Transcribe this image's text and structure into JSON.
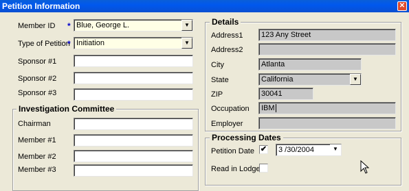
{
  "window": {
    "title": "Petition Information",
    "close_glyph": "✕"
  },
  "left": {
    "member_id": {
      "label": "Member ID",
      "required": "*",
      "value": "Blue, George L."
    },
    "type_of_petition": {
      "label": "Type of Petition",
      "required": "*",
      "value": "Initiation"
    },
    "sponsor1": {
      "label": "Sponsor #1",
      "value": ""
    },
    "sponsor2": {
      "label": "Sponsor #2",
      "value": ""
    },
    "sponsor3": {
      "label": "Sponsor #3",
      "value": ""
    }
  },
  "investigation": {
    "title": "Investigation Committee",
    "chairman": {
      "label": "Chairman",
      "value": ""
    },
    "member1": {
      "label": "Member #1",
      "value": ""
    },
    "member2": {
      "label": "Member #2",
      "value": ""
    },
    "member3": {
      "label": "Member #3",
      "value": ""
    }
  },
  "details": {
    "title": "Details",
    "address1": {
      "label": "Address1",
      "value": "123 Any Street"
    },
    "address2": {
      "label": "Address2",
      "value": ""
    },
    "city": {
      "label": "City",
      "value": "Atlanta"
    },
    "state": {
      "label": "State",
      "value": "California"
    },
    "zip": {
      "label": "ZIP",
      "value": "30041"
    },
    "occupation": {
      "label": "Occupation",
      "value": "IBM"
    },
    "employer": {
      "label": "Employer",
      "value": ""
    }
  },
  "processing": {
    "title": "Processing Dates",
    "petition_date": {
      "label": "Petition Date",
      "checked": "✔",
      "value": "3 /30/2004"
    },
    "read_in_lodge": {
      "label": "Read in Lodge",
      "checked": ""
    }
  },
  "icons": {
    "dropdown": "chevron-down-icon",
    "close": "close-icon",
    "cursor": "mouse-cursor-icon"
  }
}
